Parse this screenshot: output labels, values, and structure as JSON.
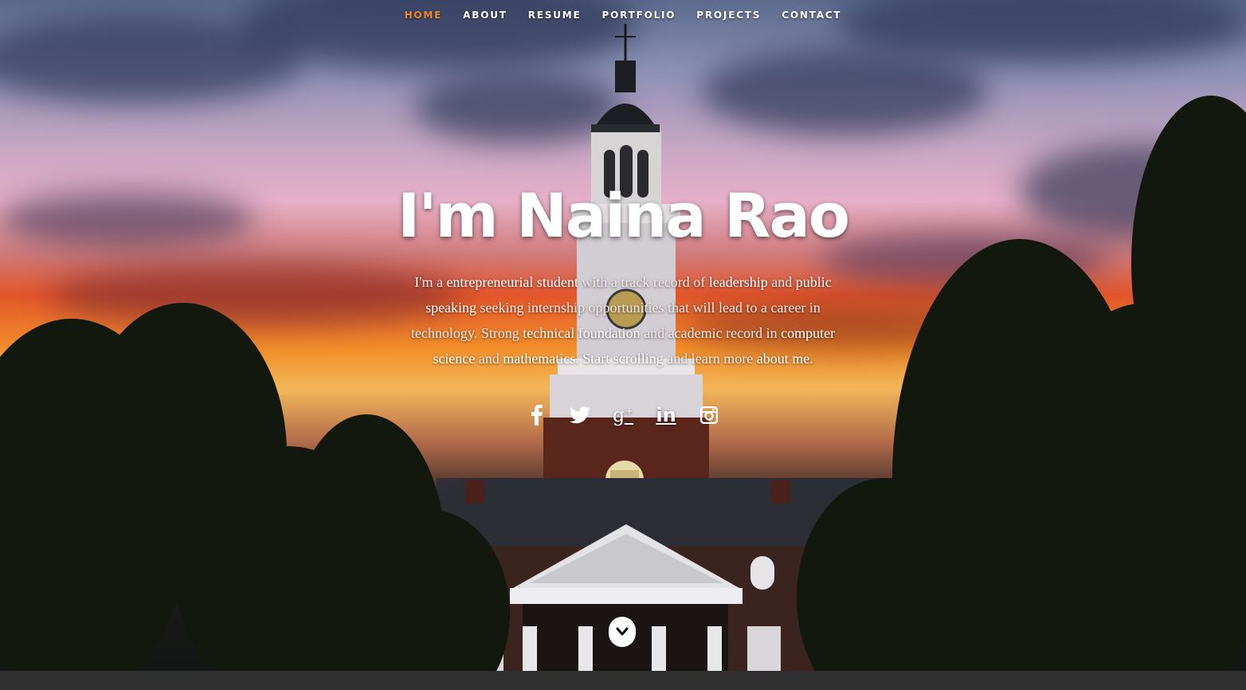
{
  "nav": {
    "items": [
      {
        "label": "HOME",
        "active": true
      },
      {
        "label": "ABOUT",
        "active": false
      },
      {
        "label": "RESUME",
        "active": false
      },
      {
        "label": "PORTFOLIO",
        "active": false
      },
      {
        "label": "PROJECTS",
        "active": false
      },
      {
        "label": "CONTACT",
        "active": false
      }
    ],
    "active_color": "#f0892b"
  },
  "hero": {
    "title": "I'm Naina Rao",
    "intro": [
      {
        "t": "I'm a ",
        "h": false
      },
      {
        "t": "entrepreneurial student",
        "h": true
      },
      {
        "t": " with a track record of ",
        "h": false
      },
      {
        "t": "leadership",
        "h": true
      },
      {
        "t": " and ",
        "h": false
      },
      {
        "t": "public speaking",
        "h": true
      },
      {
        "t": " seeking internship opportunities that will lead to a career in technology. Strong ",
        "h": false
      },
      {
        "t": "technical foundation",
        "h": true
      },
      {
        "t": " and academic record in ",
        "h": false
      },
      {
        "t": "computer science",
        "h": true
      },
      {
        "t": " and ",
        "h": false
      },
      {
        "t": "mathematics",
        "h": true
      },
      {
        "t": ". ",
        "h": false
      },
      {
        "t": "Start scrolling",
        "h": true
      },
      {
        "t": " and learn more ",
        "h": false
      },
      {
        "t": "about me",
        "h": true
      },
      {
        "t": ".",
        "h": false
      }
    ]
  },
  "social": [
    {
      "name": "facebook-icon",
      "glyph": "f"
    },
    {
      "name": "twitter-icon",
      "glyph": "twitter"
    },
    {
      "name": "google-plus-icon",
      "glyph": "g+"
    },
    {
      "name": "linkedin-icon",
      "glyph": "in"
    },
    {
      "name": "instagram-icon",
      "glyph": "insta"
    }
  ],
  "scroll_button": {
    "icon": "chevron-down-icon"
  }
}
